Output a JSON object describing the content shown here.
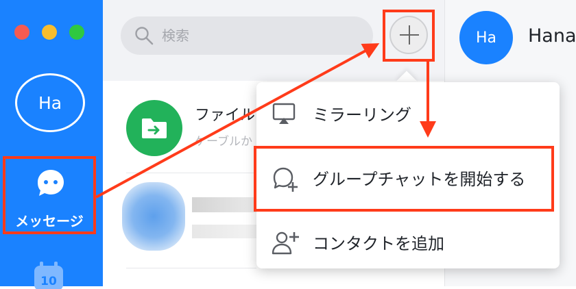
{
  "sidebar": {
    "user_initials": "Ha",
    "messages_label": "メッセージ",
    "calendar_day": "10"
  },
  "search": {
    "placeholder": "検索"
  },
  "chat_list": {
    "items": [
      {
        "name": "ファイル",
        "preview": "ケーブルか"
      }
    ]
  },
  "chat_header": {
    "initials": "Ha",
    "name": "Hana"
  },
  "create_menu": {
    "items": [
      {
        "label": "ミラーリング",
        "icon": "screen-mirror-icon"
      },
      {
        "label": "グループチャットを開始する",
        "icon": "group-chat-plus-icon"
      },
      {
        "label": "コンタクトを追加",
        "icon": "add-contact-icon"
      }
    ]
  },
  "annotation_color": "#ff3b1a"
}
